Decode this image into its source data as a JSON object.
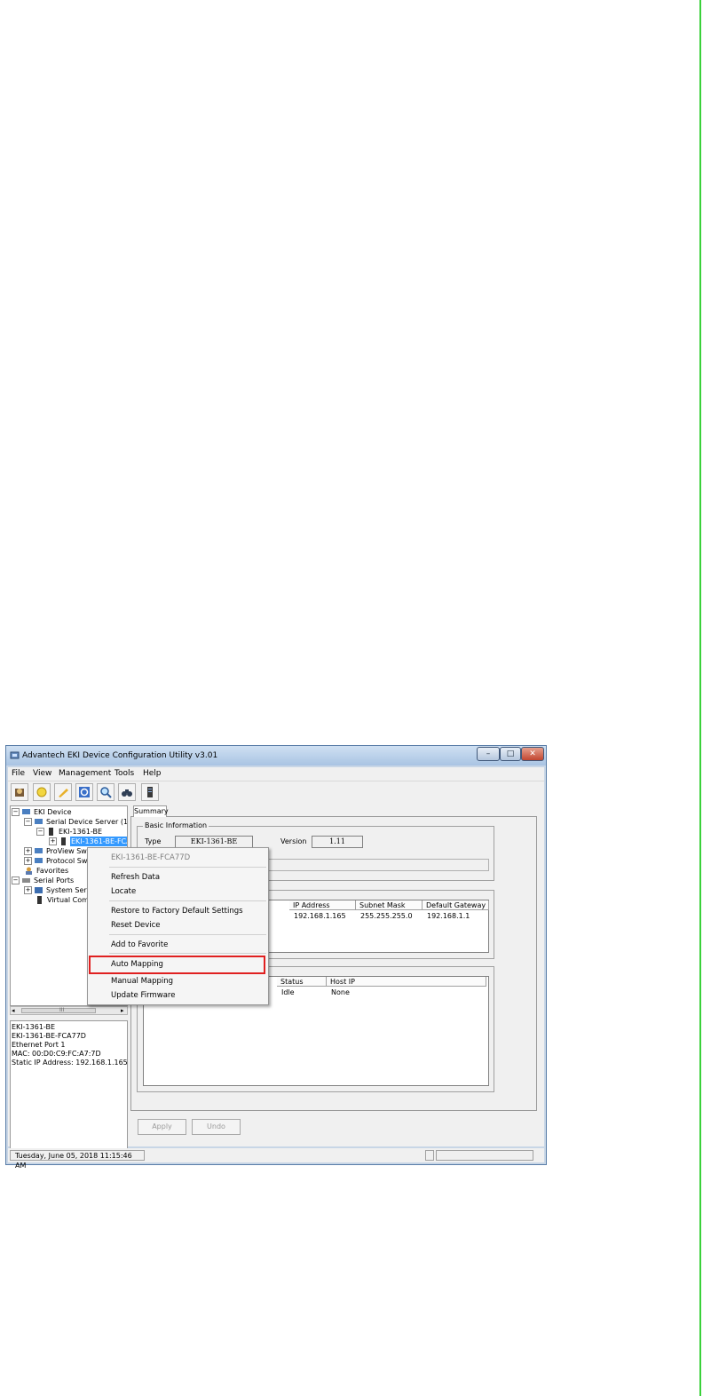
{
  "window": {
    "title": "Advantech EKI Device Configuration Utility v3.01",
    "controls": {
      "minimize": "–",
      "maximize": "□",
      "close": "✕"
    }
  },
  "menubar": [
    "File",
    "View",
    "Management",
    "Tools",
    "Help"
  ],
  "toolbar": [
    "exit-icon",
    "search-device-icon",
    "clear-icon",
    "refresh-icon",
    "locate-icon",
    "find-icon",
    "device-icon"
  ],
  "tree": {
    "root": "EKI Device",
    "serial_device_server": "Serial Device Server (1)",
    "device": "EKI-1361-BE",
    "device_port": "EKI-1361-BE-FCA",
    "proview": "ProView Swit",
    "protocol": "Protocol Swit",
    "favorites": "Favorites",
    "serial_ports": "Serial Ports",
    "system_serial": "System Serial",
    "virtual_com": "Virtual Com P"
  },
  "scroll": {
    "left": "◂",
    "mid": "III",
    "right": "▸"
  },
  "info_pane": [
    "EKI-1361-BE",
    "EKI-1361-BE-FCA77D",
    "Ethernet Port 1",
    "MAC: 00:D0:C9:FC:A7:7D",
    "Static IP Address: 192.168.1.165"
  ],
  "tab": "Summary",
  "basic_info": {
    "title": "Basic Information",
    "type_label": "Type",
    "type_value": "EKI-1361-BE",
    "version_label": "Version",
    "version_value": "1.11"
  },
  "network_table": {
    "headers": [
      "IP Address",
      "Subnet Mask",
      "Default Gateway"
    ],
    "row": [
      "192.168.1.165",
      "255.255.255.0",
      "192.168.1.1"
    ]
  },
  "port_table": {
    "headers": [
      "Status",
      "Host IP"
    ],
    "row": [
      "Idle",
      "None"
    ]
  },
  "buttons": {
    "apply": "Apply",
    "undo": "Undo"
  },
  "statusbar": {
    "datetime": "Tuesday, June 05, 2018  11:15:46 AM"
  },
  "context_menu": {
    "header": "EKI-1361-BE-FCA77D",
    "refresh": "Refresh Data",
    "locate": "Locate",
    "restore": "Restore to Factory Default Settings",
    "reset": "Reset Device",
    "favorite": "Add to Favorite",
    "auto_mapping": "Auto Mapping",
    "manual_mapping": "Manual Mapping",
    "update_firmware": "Update Firmware"
  },
  "colors": {
    "highlight": "#e02020",
    "selection": "#3399ff",
    "page_edge": "#3ad13a"
  }
}
